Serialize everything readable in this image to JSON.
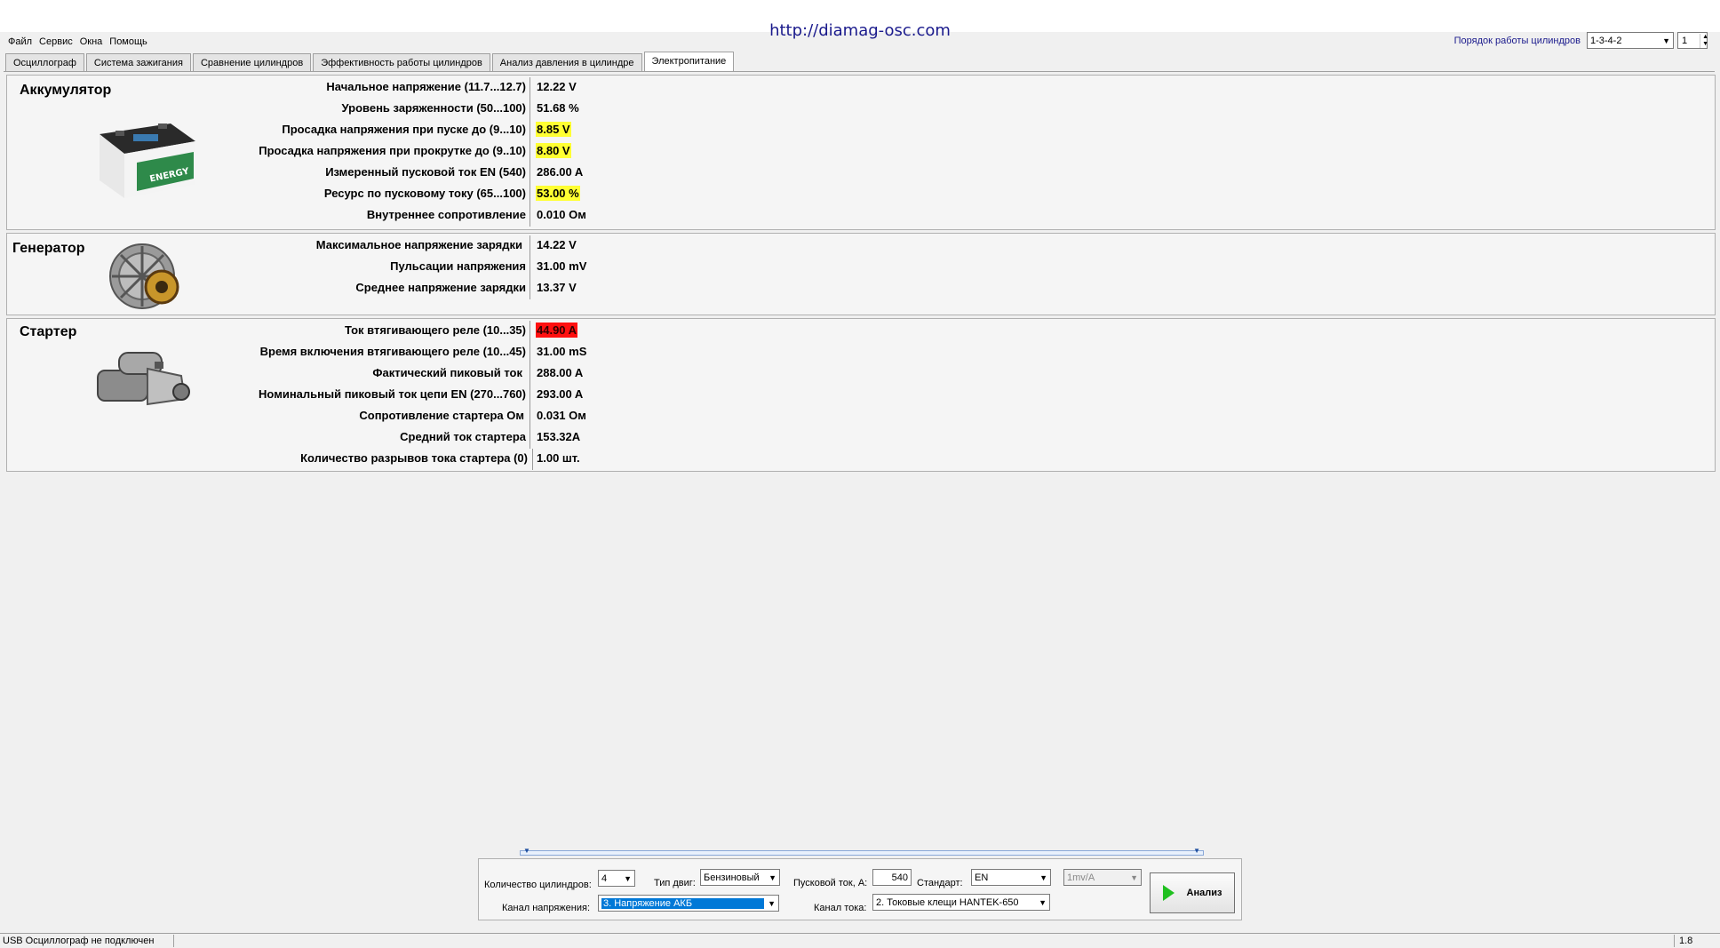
{
  "header": {
    "url": "http://diamag-osc.com"
  },
  "menu": [
    "Файл",
    "Сервис",
    "Окна",
    "Помощь"
  ],
  "cylinder_order": {
    "label": "Порядок работы цилиндров",
    "value": "1-3-4-2",
    "spin_value": "1"
  },
  "tabs": [
    {
      "label": "Осциллограф",
      "active": false
    },
    {
      "label": "Система зажигания",
      "active": false
    },
    {
      "label": "Сравнение цилиндров",
      "active": false
    },
    {
      "label": "Эффективность работы цилиндров",
      "active": false
    },
    {
      "label": "Анализ давления в цилиндре",
      "active": false
    },
    {
      "label": "Электропитание",
      "active": true
    }
  ],
  "battery": {
    "title": "Аккумулятор",
    "rows": [
      {
        "label": "Начальное напряжение (11.7...12.7)",
        "value": "12.22 V"
      },
      {
        "label": "Уровень заряженности (50...100)",
        "value": "51.68 %"
      },
      {
        "label": "Просадка напряжения при пуске до (9...10)",
        "value": "8.85 V"
      },
      {
        "label": "Просадка напряжения при прокрутке до  (9..10)",
        "value": "8.80 V"
      },
      {
        "label": "Измеренный пусковой ток  EN (540)",
        "value": "286.00 A"
      },
      {
        "label": "Ресурс по пусковому току (65...100)",
        "value": "53.00 %"
      },
      {
        "label": "Внутреннее сопротивление",
        "value": "0.010 Ом"
      }
    ],
    "image_text": "ENERGY"
  },
  "generator": {
    "title": "Генератор",
    "rows": [
      {
        "label": "Максимальное напряжение зарядки",
        "value": "14.22 V"
      },
      {
        "label": "Пульсации напряжения",
        "value": "31.00 mV"
      },
      {
        "label": "Среднее напряжение зарядки",
        "value": "13.37 V"
      }
    ]
  },
  "starter": {
    "title": "Стартер",
    "rows": [
      {
        "label": "Ток втягивающего реле (10...35)",
        "value": "44.90 A"
      },
      {
        "label": "Время включения втягивающего реле (10...45)",
        "value": "31.00 mS"
      },
      {
        "label": "Фактический пиковый ток",
        "value": "288.00 A"
      },
      {
        "label": "Номинальный пиковый ток цепи EN (270...760)",
        "value": "293.00 A"
      },
      {
        "label": "Сопротивление стартера Ом",
        "value": "0.031 Ом"
      },
      {
        "label": "Средний ток стартера",
        "value": "153.32A"
      },
      {
        "label": "Количество разрывов тока стартера (0)",
        "value": "1.00 шт."
      }
    ]
  },
  "controls": {
    "cyl_count_label": "Количество цилиндров:",
    "cyl_count_value": "4",
    "engine_type_label": "Тип двиг:",
    "engine_type_value": "Бензиновый",
    "start_current_label": "Пусковой ток, А:",
    "start_current_value": "540",
    "standard_label": "Стандарт:",
    "standard_value": "EN",
    "scale_value": "1mv/A",
    "voltage_channel_label": "Канал напряжения:",
    "voltage_channel_value": "3.  Напряжение АКБ",
    "current_channel_label": "Канал тока:",
    "current_channel_value": "2.  Токовые клещи HANTEK-650",
    "analyze_label": "Анализ"
  },
  "status": {
    "left": "USB Осциллограф не подключен",
    "right": "1.8"
  },
  "colors": {
    "warn": "#ffff32",
    "error": "#ff1010",
    "accent": "#1a1a8c"
  }
}
